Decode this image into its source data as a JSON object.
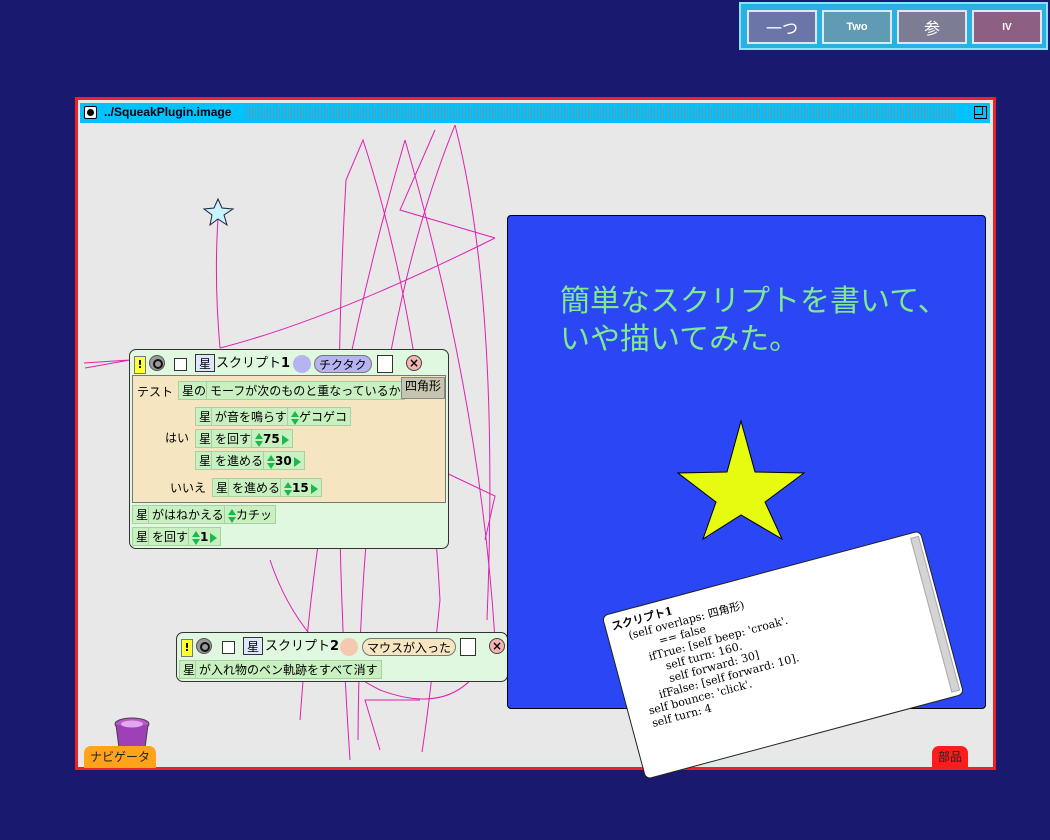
{
  "flaps": [
    {
      "label": "一つ",
      "bg": "#6c75a8"
    },
    {
      "label": "Two",
      "bg": "#5f9bb3"
    },
    {
      "label": "参",
      "bg": "#7c7c95"
    },
    {
      "label": "IV",
      "bg": "#8c5f83"
    }
  ],
  "window": {
    "title": "../SqueakPlugin.image"
  },
  "script1": {
    "player": "星",
    "name": "スクリプト",
    "number": "1",
    "trigger": "チクタク",
    "test_label": "テスト",
    "test_subject": "星の",
    "test_condition": "モーフが次のものと重なっているか",
    "test_target": "四角形",
    "yes_label": "はい",
    "no_label": "いいえ",
    "yes_rows": [
      {
        "subject": "星",
        "verb": "が音を鳴らす",
        "value": "ゲコゲコ"
      },
      {
        "subject": "星",
        "verb": "を回す",
        "value": "75"
      },
      {
        "subject": "星",
        "verb": "を進める",
        "value": "30"
      }
    ],
    "no_row": {
      "subject": "星",
      "verb": "を進める",
      "value": "15"
    },
    "after_rows": [
      {
        "subject": "星",
        "verb": "がはねかえる",
        "value": "カチッ"
      },
      {
        "subject": "星",
        "verb": "を回す",
        "value": "1"
      }
    ]
  },
  "script2": {
    "player": "星",
    "name": "スクリプト",
    "number": "2",
    "trigger": "マウスが入った",
    "row": {
      "subject": "星",
      "verb": "が入れ物のペン軌跡をすべて消す"
    }
  },
  "panel": {
    "line1": "簡単なスクリプトを書いて、",
    "line2": "いや描いてみた。"
  },
  "code": {
    "lines": [
      "スクリプト1",
      "    (self overlaps: 四角形)",
      "            == false",
      "        ifTrue: [self beep: 'croak'.",
      "            self turn: 160.",
      "            self forward: 30]",
      "        ifFalse: [self forward: 10].",
      "    self bounce: 'click'.",
      "    self turn: 4"
    ]
  },
  "tabs": {
    "navigator": "ナビゲータ",
    "parts": "部品"
  },
  "colors": {
    "desktop": "#191970",
    "window_border": "#ee2222",
    "titlebar": "#00c2ff",
    "panel": "#2b46f5",
    "panel_text": "#80ea8e",
    "star": "#e6fb10",
    "pen_trail": "#e020b0"
  }
}
